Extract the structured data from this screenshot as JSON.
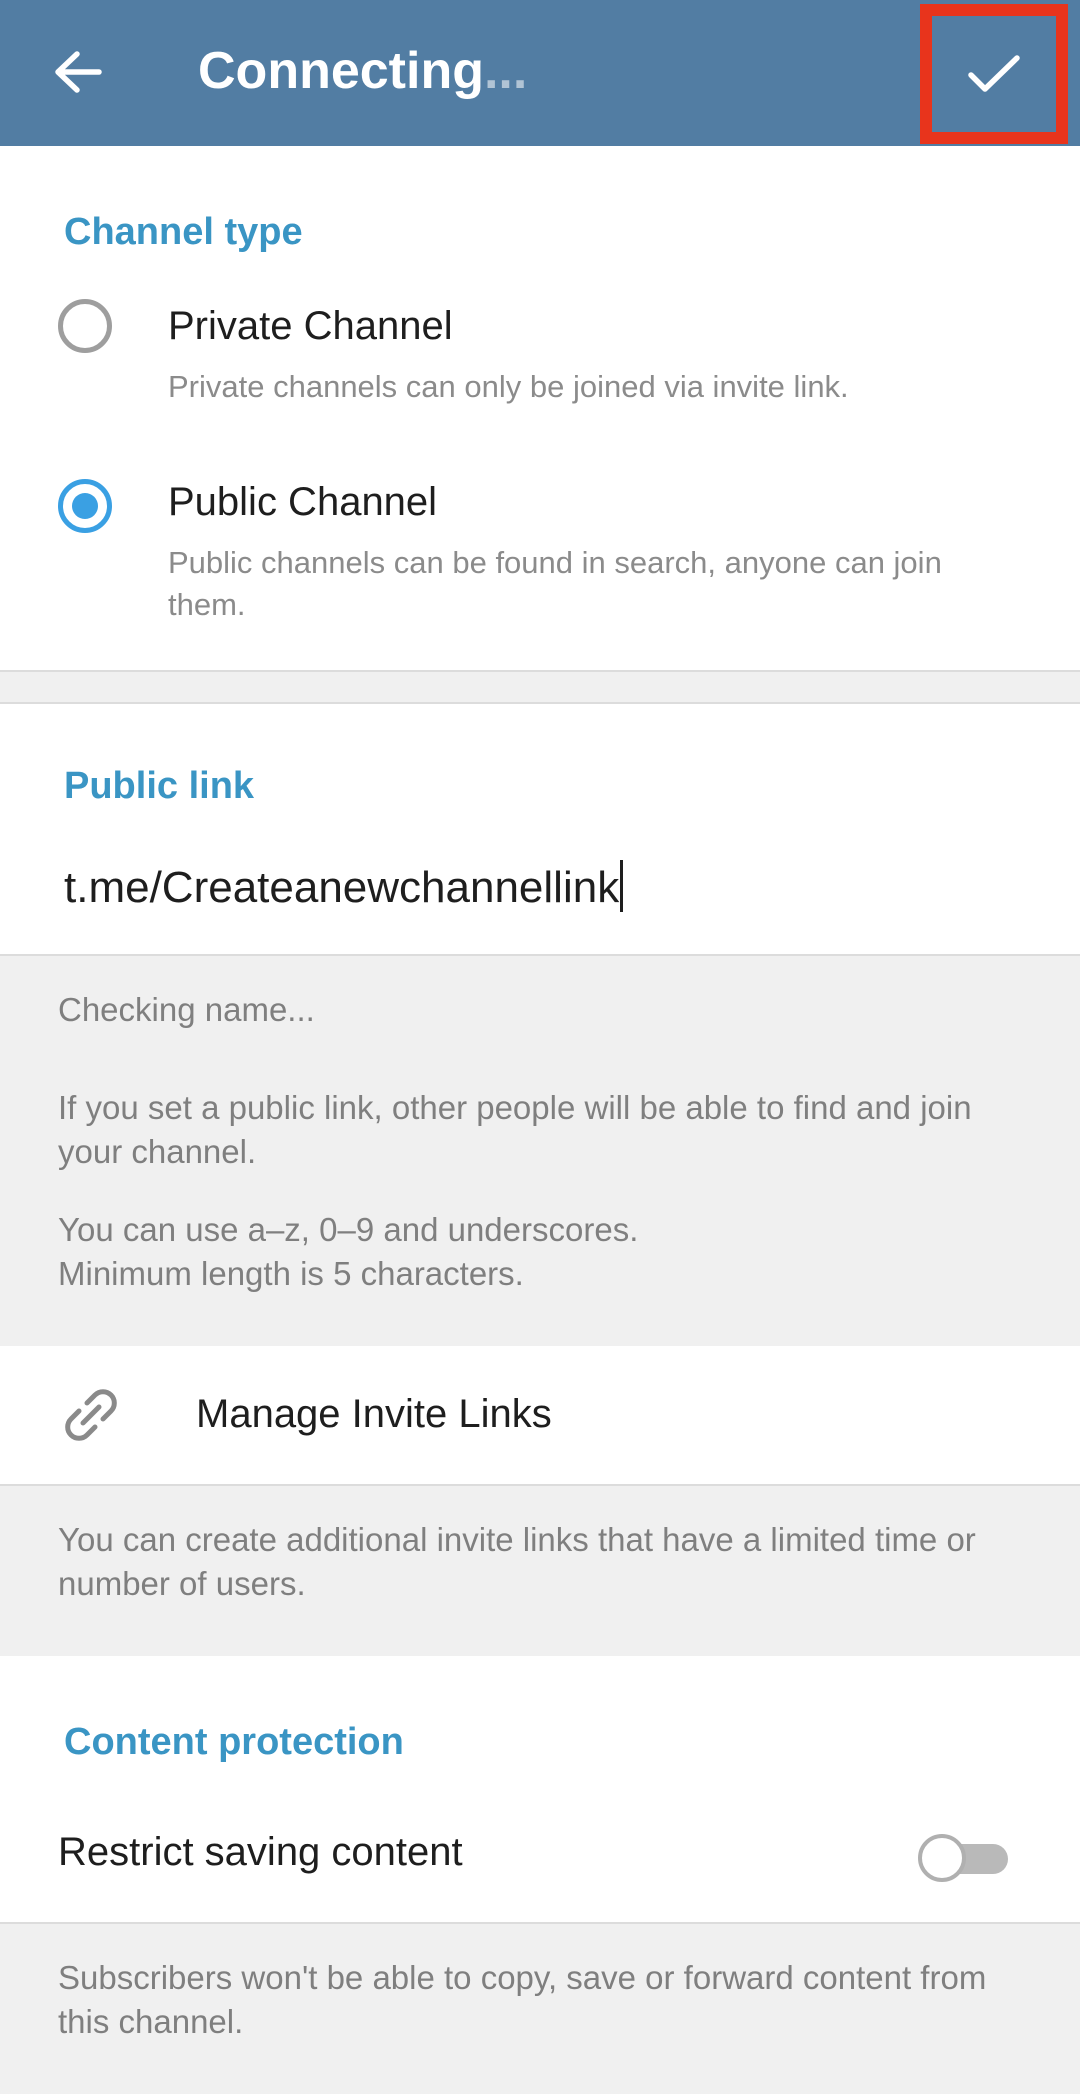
{
  "header": {
    "title": "Connecting",
    "title_dots": "...",
    "colors": {
      "bar": "#527da3",
      "highlight": "#e8341c"
    },
    "icons": {
      "back": "arrow-left-icon",
      "done": "checkmark-icon"
    }
  },
  "channel_type": {
    "title": "Channel type",
    "options": [
      {
        "label": "Private Channel",
        "description": "Private channels can only be joined via invite link.",
        "selected": false
      },
      {
        "label": "Public Channel",
        "description": "Public channels can be found in search, anyone can join them.",
        "selected": true
      }
    ]
  },
  "public_link": {
    "title": "Public link",
    "value": "t.me/Createanewchannellink",
    "status": "Checking name...",
    "info_1": "If you set a public link, other people will be able to find and join your channel.",
    "info_2_line1": "You can use a–z, 0–9 and underscores.",
    "info_2_line2": "Minimum length is 5 characters."
  },
  "invite_links": {
    "label": "Manage Invite Links",
    "icon": "link-icon",
    "info": "You can create additional invite links that have a limited time or number of users."
  },
  "content_protection": {
    "title": "Content protection",
    "toggle_label": "Restrict saving content",
    "toggle_on": false,
    "info": "Subscribers won't be able to copy, save or forward content from this channel."
  },
  "accent_color": "#3a95c4",
  "radio_color": "#3aa0e3"
}
